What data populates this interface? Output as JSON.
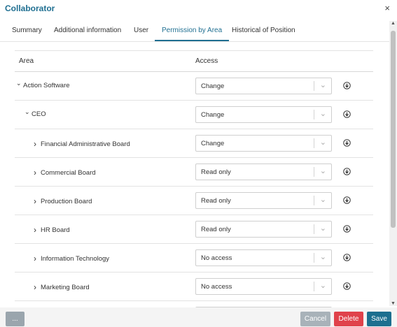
{
  "window": {
    "title": "Collaborator",
    "close_label": "×"
  },
  "tabs": [
    {
      "label": "Summary"
    },
    {
      "label": "Additional information"
    },
    {
      "label": "User"
    },
    {
      "label": "Permission by Area"
    },
    {
      "label": "Historical of Position"
    }
  ],
  "active_tab": "Permission by Area",
  "table": {
    "headers": {
      "area": "Area",
      "access": "Access"
    },
    "rows": [
      {
        "area": "Action Software",
        "access": "Change",
        "expanded": true,
        "level": 0
      },
      {
        "area": "CEO",
        "access": "Change",
        "expanded": true,
        "level": 1
      },
      {
        "area": "Financial Administrative Board",
        "access": "Change",
        "expanded": false,
        "level": 2
      },
      {
        "area": "Commercial Board",
        "access": "Read only",
        "expanded": false,
        "level": 2
      },
      {
        "area": "Production Board",
        "access": "Read only",
        "expanded": false,
        "level": 2
      },
      {
        "area": "HR Board",
        "access": "Read only",
        "expanded": false,
        "level": 2
      },
      {
        "area": "Information Technology",
        "access": "No access",
        "expanded": false,
        "level": 2
      },
      {
        "area": "Marketing Board",
        "access": "No access",
        "expanded": false,
        "level": 2
      }
    ]
  },
  "footer": {
    "more_label": "...",
    "cancel_label": "Cancel",
    "delete_label": "Delete",
    "save_label": "Save"
  },
  "colors": {
    "accent": "#1f6f91",
    "delete": "#e0424b",
    "save": "#1c6f8f",
    "cancel": "#a8b2b9"
  },
  "icons": {
    "expand": "chevron-down-icon",
    "collapse": "chevron-right-icon",
    "download": "download-circle-icon"
  }
}
